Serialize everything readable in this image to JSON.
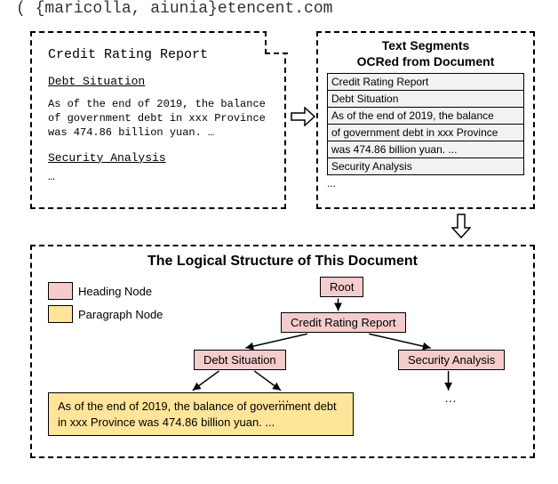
{
  "top_cropped_text": "( {maricolla, aiunia}etencent.com",
  "document": {
    "title": "Credit Rating Report",
    "heading1": "Debt Situation",
    "body1": "As of the end of 2019, the balance of government debt in xxx Province was 474.86 billion yuan. …",
    "heading2": "Security Analysis",
    "dots": "…"
  },
  "segments_panel": {
    "title_line1": "Text Segments",
    "title_line2": "OCRed from Document",
    "rows": [
      "Credit Rating Report",
      "Debt Situation",
      "As of the end of 2019, the balance",
      "of government debt in xxx Province",
      "was 474.86 billion yuan. ...",
      "Security Analysis"
    ],
    "dots": "..."
  },
  "tree": {
    "title": "The Logical Structure of This Document",
    "legend": {
      "heading": "Heading Node",
      "paragraph": "Paragraph Node"
    },
    "nodes": {
      "root": "Root",
      "doc_title": "Credit Rating Report",
      "h1": "Debt Situation",
      "h2": "Security Analysis",
      "para": "As of the end of 2019, the balance of government debt in xxx Province was 474.86 billion yuan. ..."
    },
    "dots": "…"
  },
  "colors": {
    "heading_node": "#f4cccc",
    "paragraph_node": "#ffe599"
  }
}
